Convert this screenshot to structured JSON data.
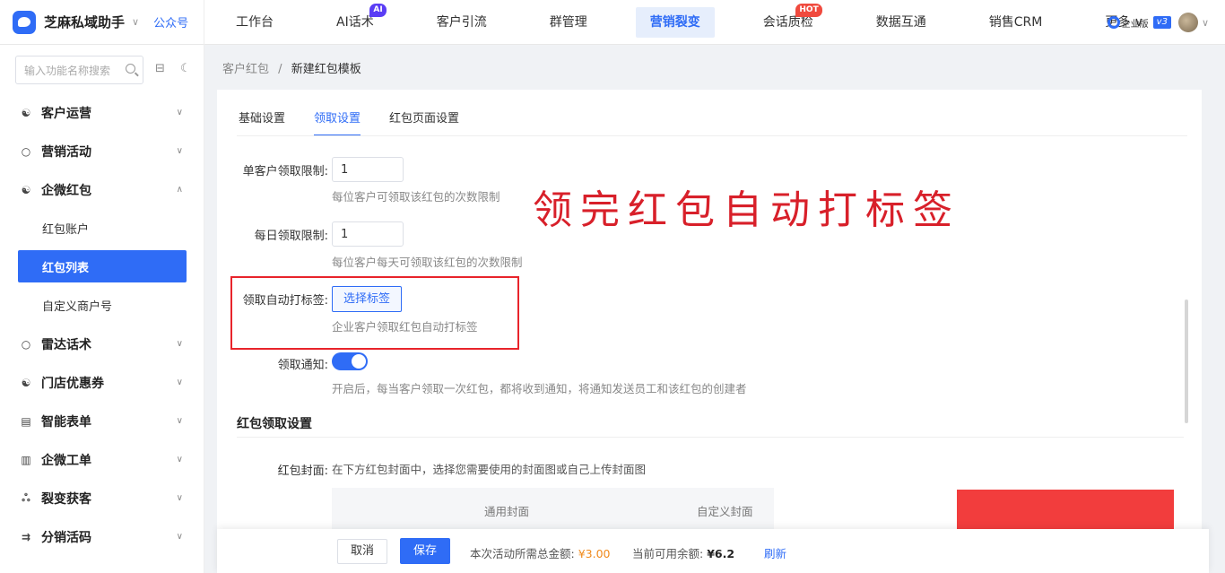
{
  "brand": {
    "name": "芝麻私域助手",
    "caret": "∨",
    "link": "公众号"
  },
  "nav": {
    "items": [
      {
        "label": "工作台"
      },
      {
        "label": "AI话术",
        "badge": "AI"
      },
      {
        "label": "客户引流"
      },
      {
        "label": "群管理"
      },
      {
        "label": "营销裂变",
        "active": true
      },
      {
        "label": "会话质检",
        "badge": "HOT"
      },
      {
        "label": "数据互通"
      },
      {
        "label": "销售CRM"
      },
      {
        "label": "更多 ∨"
      }
    ]
  },
  "account": {
    "edition": "企业版",
    "version": "v3",
    "caret": "∨"
  },
  "sidebar": {
    "search_placeholder": "输入功能名称搜索",
    "items": [
      {
        "label": "客户运营",
        "icon": "☯",
        "chev": "∨"
      },
      {
        "label": "营销活动",
        "icon": "○",
        "chev": "∨"
      },
      {
        "label": "企微红包",
        "icon": "☯",
        "chev": "∧"
      },
      {
        "label": "雷达话术",
        "icon": "○",
        "chev": "∨"
      },
      {
        "label": "门店优惠券",
        "icon": "☯",
        "chev": "∨"
      },
      {
        "label": "智能表单",
        "icon": "▤",
        "chev": "∨"
      },
      {
        "label": "企微工单",
        "icon": "▥",
        "chev": "∨"
      },
      {
        "label": "裂变获客",
        "icon": "ஃ",
        "chev": "∨"
      },
      {
        "label": "分销活码",
        "icon": "⇉",
        "chev": "∨"
      }
    ],
    "subitems": [
      {
        "label": "红包账户"
      },
      {
        "label": "红包列表",
        "active": true
      },
      {
        "label": "自定义商户号"
      }
    ]
  },
  "breadcrumb": {
    "parent": "客户红包",
    "sep": "/",
    "current": "新建红包模板"
  },
  "tabs": [
    {
      "label": "基础设置"
    },
    {
      "label": "领取设置",
      "active": true
    },
    {
      "label": "红包页面设置"
    }
  ],
  "form": {
    "per_customer": {
      "label": "单客户领取限制:",
      "value": "1",
      "hint": "每位客户可领取该红包的次数限制"
    },
    "per_day": {
      "label": "每日领取限制:",
      "value": "1",
      "hint": "每位客户每天可领取该红包的次数限制"
    },
    "auto_tag": {
      "label": "领取自动打标签:",
      "button": "选择标签",
      "hint": "企业客户领取红包自动打标签"
    },
    "notify": {
      "label": "领取通知:",
      "enabled": true,
      "hint": "开启后，每当客户领取一次红包，都将收到通知，将通知发送员工和该红包的创建者"
    }
  },
  "section": {
    "title": "红包领取设置",
    "cover_label": "红包封面:",
    "cover_hint": "在下方红包封面中，选择您需要使用的封面图或自己上传封面图",
    "cover_tabs": [
      "通用封面",
      "自定义封面"
    ]
  },
  "callout": "领完红包自动打标签",
  "footer": {
    "cancel": "取消",
    "save": "保存",
    "total_label": "本次活动所需总金额:",
    "total_value": "¥3.00",
    "balance_label": "当前可用余额:",
    "balance_value": "¥6.2",
    "refresh": "刷新"
  },
  "colors": {
    "accent": "#2f6cf6",
    "annotation": "#e8242b",
    "amount": "#f08a1c"
  }
}
